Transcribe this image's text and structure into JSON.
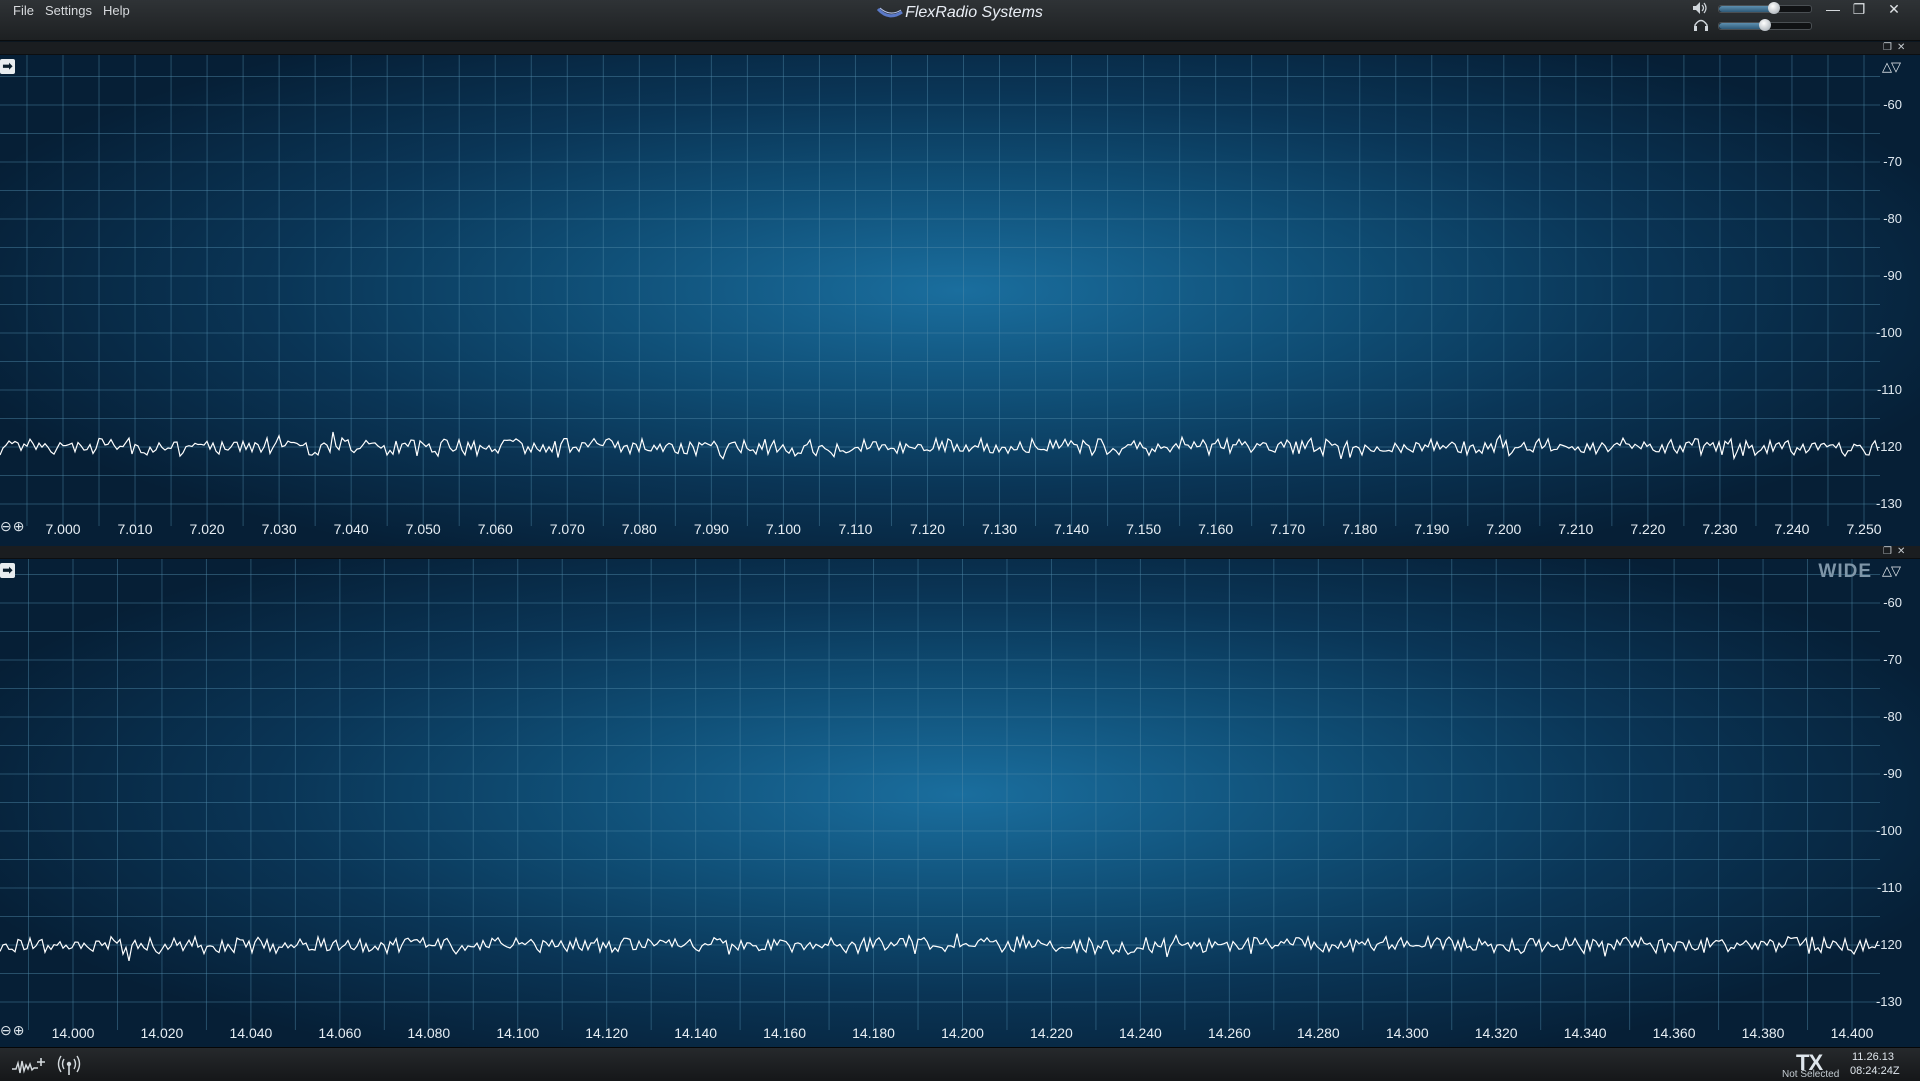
{
  "menu": {
    "file": "File",
    "settings": "Settings",
    "help": "Help"
  },
  "app": {
    "title": "FlexRadio Systems"
  },
  "window": {
    "minimize": "—",
    "restore": "❐",
    "close": "✕"
  },
  "audio": {
    "speaker_volume": 0.6,
    "headphone_volume": 0.5
  },
  "panadapters": [
    {
      "id": "pan1",
      "mode_label": "",
      "db_labels": [
        "-60",
        "-70",
        "-80",
        "-90",
        "-100",
        "-110",
        "-120",
        "-130"
      ],
      "freq_labels": [
        "7.000",
        "7.010",
        "7.020",
        "7.030",
        "7.040",
        "7.050",
        "7.060",
        "7.070",
        "7.080",
        "7.090",
        "7.100",
        "7.110",
        "7.120",
        "7.130",
        "7.140",
        "7.150",
        "7.160",
        "7.170",
        "7.180",
        "7.190",
        "7.200",
        "7.210",
        "7.220",
        "7.230",
        "7.240",
        "7.250"
      ],
      "noise_floor_db": -120
    },
    {
      "id": "pan2",
      "mode_label": "WIDE",
      "db_labels": [
        "-60",
        "-70",
        "-80",
        "-90",
        "-100",
        "-110",
        "-120",
        "-130"
      ],
      "freq_labels": [
        "14.000",
        "14.020",
        "14.040",
        "14.060",
        "14.080",
        "14.100",
        "14.120",
        "14.140",
        "14.160",
        "14.180",
        "14.200",
        "14.220",
        "14.240",
        "14.260",
        "14.280",
        "14.300",
        "14.320",
        "14.340",
        "14.360",
        "14.380",
        "14.400"
      ],
      "noise_floor_db": -120
    }
  ],
  "status": {
    "tx": "TX",
    "tx_sub": "Not Selected",
    "date": "11.26.13",
    "time": "08:24:24Z"
  },
  "icons": {
    "add_pan": "add-panadapter-icon",
    "tnf": "tnf-icon",
    "speaker": "speaker-icon",
    "headphones": "headphones-icon"
  },
  "colors": {
    "accent": "#1a6e9e",
    "trace": "#ffffff",
    "grid": "#4f8aa8"
  }
}
